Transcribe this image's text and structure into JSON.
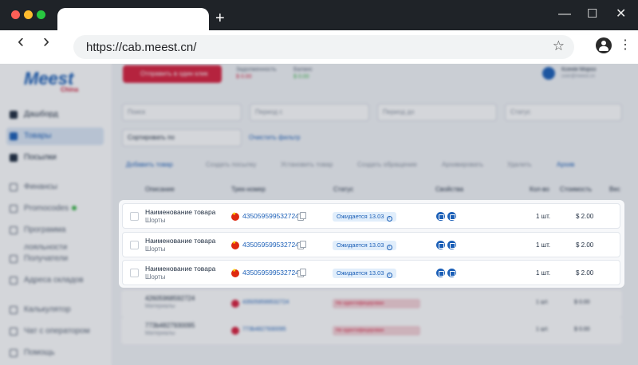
{
  "browser": {
    "url": "https://cab.meest.cn/",
    "traffic_colors": [
      "#ff5f57",
      "#febc2e",
      "#28c840"
    ],
    "new_tab_label": "+",
    "back_icon": "‹",
    "forward_icon": "›",
    "bookmark_icon": "☆",
    "menu_icon": "⋮",
    "minimize_icon": "—",
    "maximize_icon": "☐",
    "close_icon": "✕"
  },
  "sidebar": {
    "logo": "Meest",
    "logo_sub": "China",
    "items": [
      {
        "label": "Дашборд"
      },
      {
        "label": "Товары"
      },
      {
        "label": "Посылки"
      },
      {
        "label": "Финансы"
      },
      {
        "label": "Promocodes"
      },
      {
        "label": "Программа лояльности"
      },
      {
        "label": "Получатели"
      },
      {
        "label": "Адреса складов"
      },
      {
        "label": "Калькулятор"
      },
      {
        "label": "Чат с оператором"
      },
      {
        "label": "Помощь"
      }
    ]
  },
  "header": {
    "send_button": "Отправить в один клик",
    "balance1_label": "Задолженность",
    "balance1_value": "$ 0.00",
    "balance2_label": "Баланс",
    "balance2_value": "$ 0.00",
    "user_name": "Ксенія Мороз",
    "user_sub": "user@meest.cn"
  },
  "filters": {
    "search": "Поиск",
    "period_from": "Период с",
    "period_to": "Период до",
    "status": "Статус",
    "sort": "Сортировать по",
    "clear": "Очистить фильтр"
  },
  "actions": [
    {
      "label": "Добавить товар"
    },
    {
      "label": "Создать посылку"
    },
    {
      "label": "Установить товар"
    },
    {
      "label": "Создать обращение"
    },
    {
      "label": "Архивировать"
    },
    {
      "label": "Удалить"
    },
    {
      "label": "Архив"
    }
  ],
  "table": {
    "headers": {
      "description": "Описание",
      "track": "Трек-номер",
      "status": "Статус",
      "props": "Свойства",
      "qty": "Кол-во",
      "cost": "Стоимость",
      "weight": "Вес"
    },
    "rows": [
      {
        "name": "Наименование товара",
        "category": "Шорты",
        "track": "435059599532724",
        "status": "Ожидается 13.03",
        "qty": "1 шт.",
        "price": "$ 2.00"
      },
      {
        "name": "Наименование товара",
        "category": "Шорты",
        "track": "435059599532724",
        "status": "Ожидается 13.03",
        "qty": "1 шт.",
        "price": "$ 2.00"
      },
      {
        "name": "Наименование товара",
        "category": "Шорты",
        "track": "435059599532724",
        "status": "Ожидается 13.03",
        "qty": "1 шт.",
        "price": "$ 2.00"
      }
    ],
    "bg_rows": [
      {
        "name": "42605968592724",
        "category": "Материалы",
        "track": "435059599532724",
        "status": "Не идентифицирован",
        "qty": "1 шт.",
        "price": "$ 0.00"
      },
      {
        "name": "773b4827930095",
        "category": "Материалы",
        "track": "773b4827930095",
        "status": "Не идентифицирован",
        "qty": "1 шт.",
        "price": "$ 0.00"
      }
    ]
  }
}
